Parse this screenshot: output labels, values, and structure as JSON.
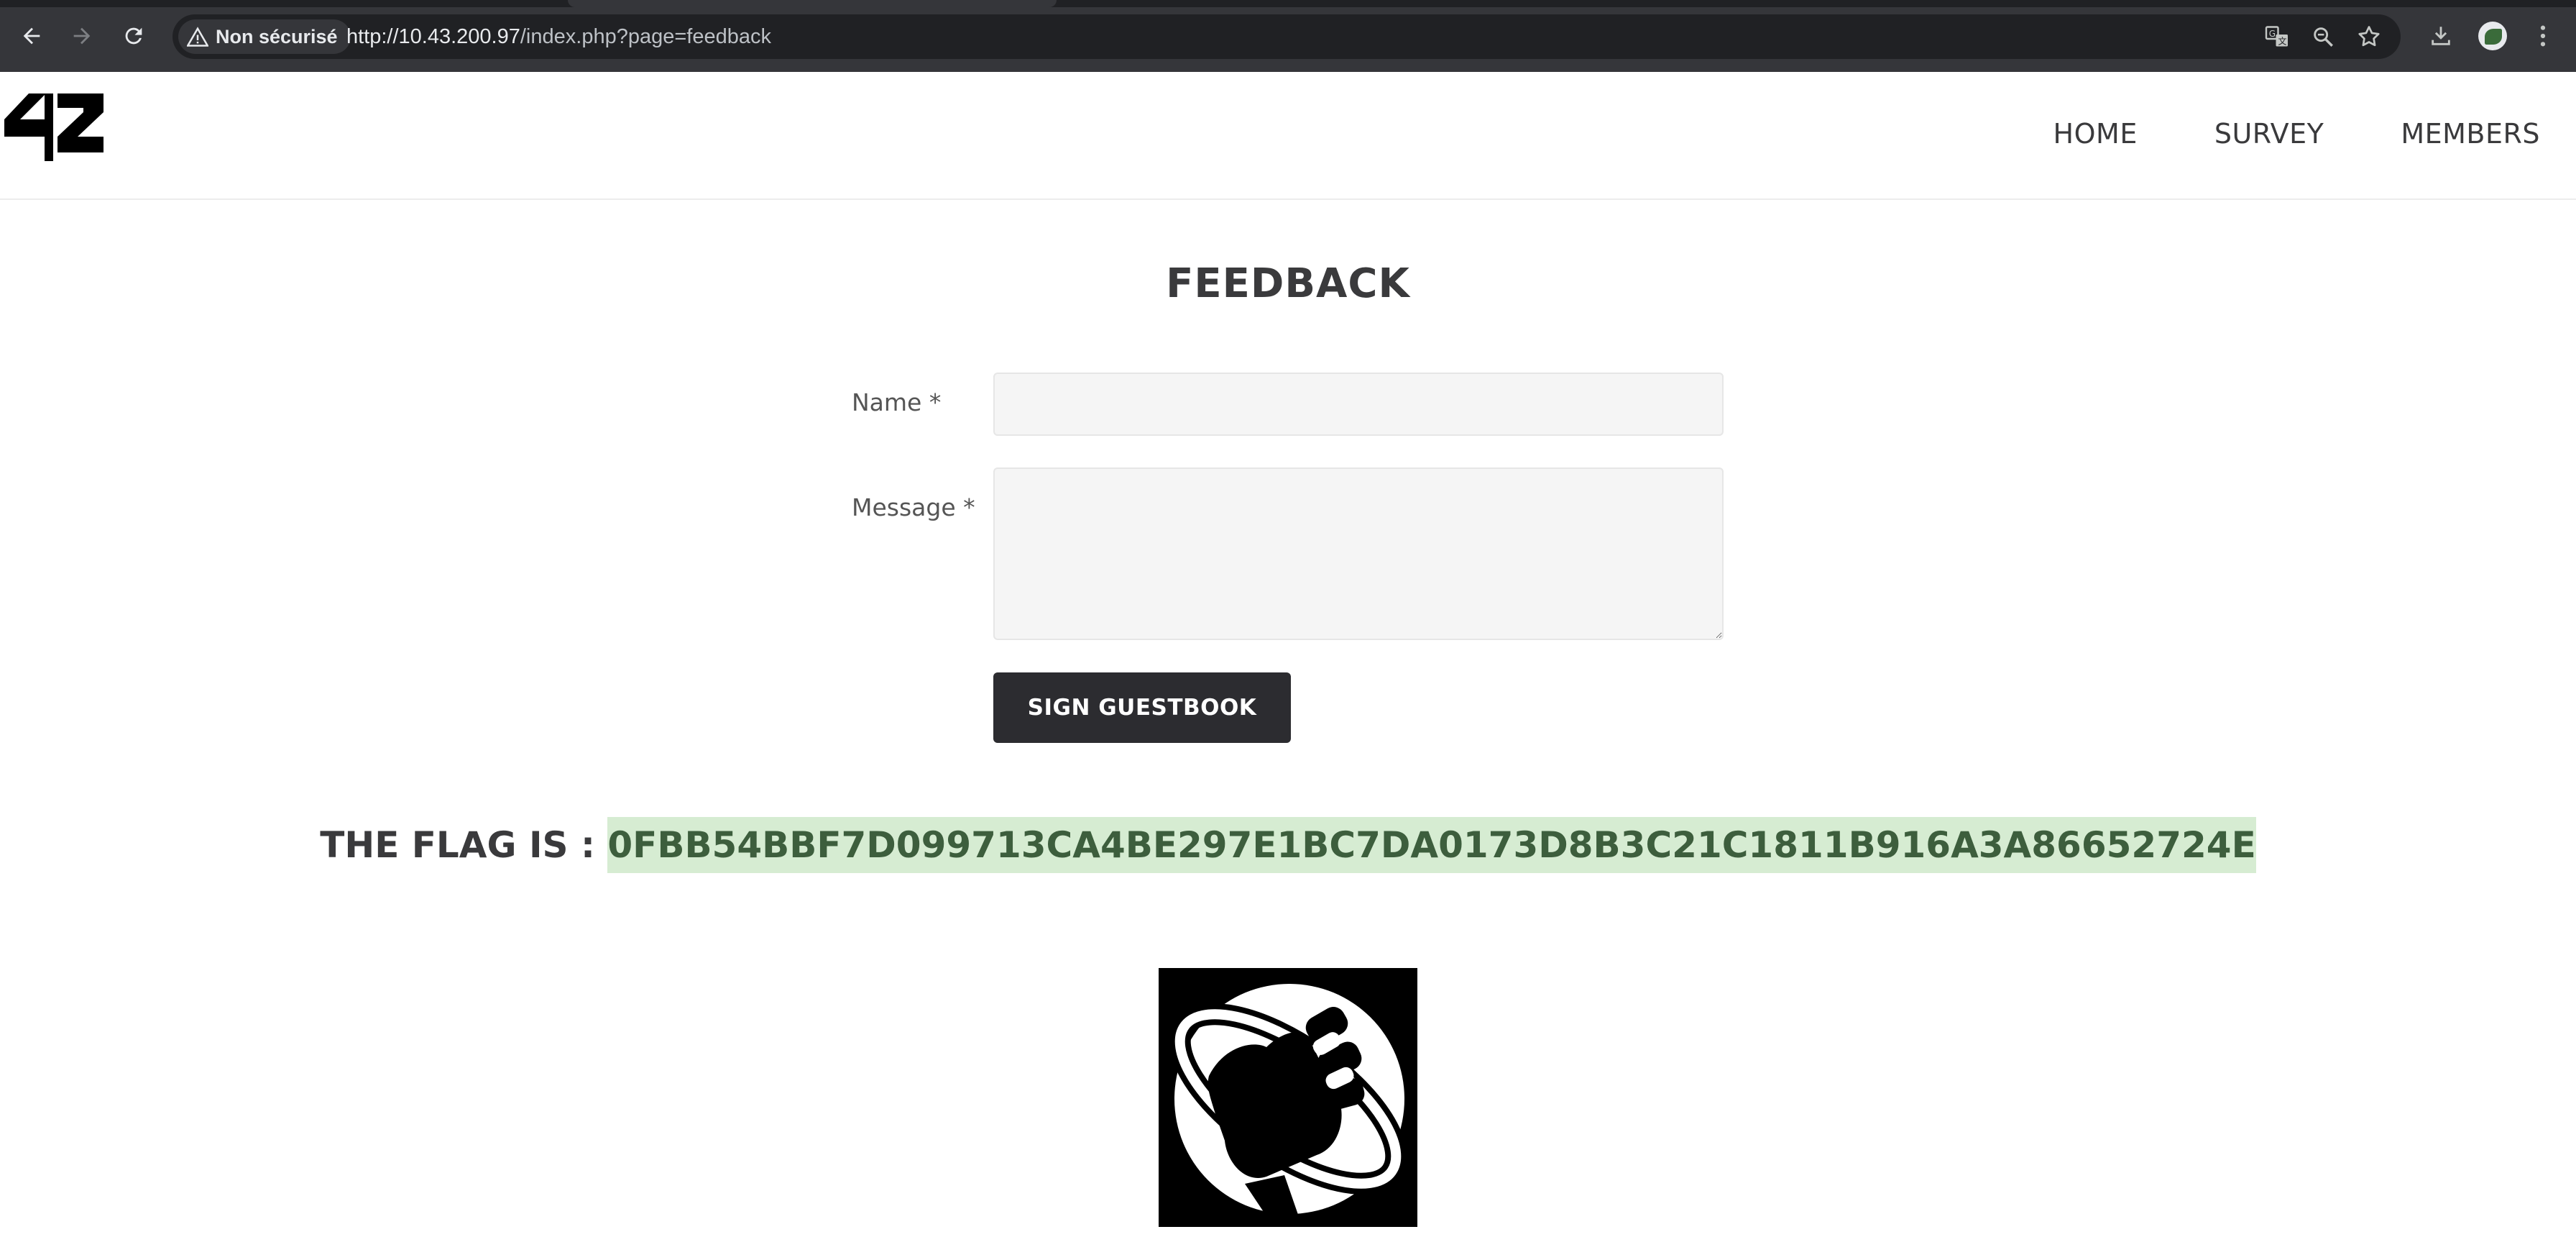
{
  "browser": {
    "security_label": "Non sécurisé",
    "url_host": "http://10.43.200.97",
    "url_path": "/index.php?page=feedback",
    "icons": [
      "back-arrow-icon",
      "forward-arrow-icon",
      "reload-icon",
      "warning-icon",
      "translate-icon",
      "zoom-icon",
      "bookmark-star-icon",
      "download-icon",
      "profile-avatar",
      "kebab-menu-icon"
    ]
  },
  "site": {
    "logo_alt": "42",
    "nav": [
      {
        "label": "HOME"
      },
      {
        "label": "SURVEY"
      },
      {
        "label": "MEMBERS"
      }
    ]
  },
  "main": {
    "title": "FEEDBACK",
    "form": {
      "name_label": "Name *",
      "name_value": "",
      "message_label": "Message *",
      "message_value": "",
      "submit_label": "SIGN GUESTBOOK"
    },
    "flag_prefix": "THE FLAG IS :",
    "flag_value": "0FBB54BBF7D099713CA4BE297E1BC7DA0173D8B3C21C1811B916A3A86652724E",
    "image": "hitchhiker-thumb-planet-logo"
  },
  "colors": {
    "chrome_bg": "#35363a",
    "omnibox_bg": "#202124",
    "button_bg": "#2c2c30",
    "flag_highlight": "#d6ecd2",
    "text": "#3a3a3c"
  }
}
